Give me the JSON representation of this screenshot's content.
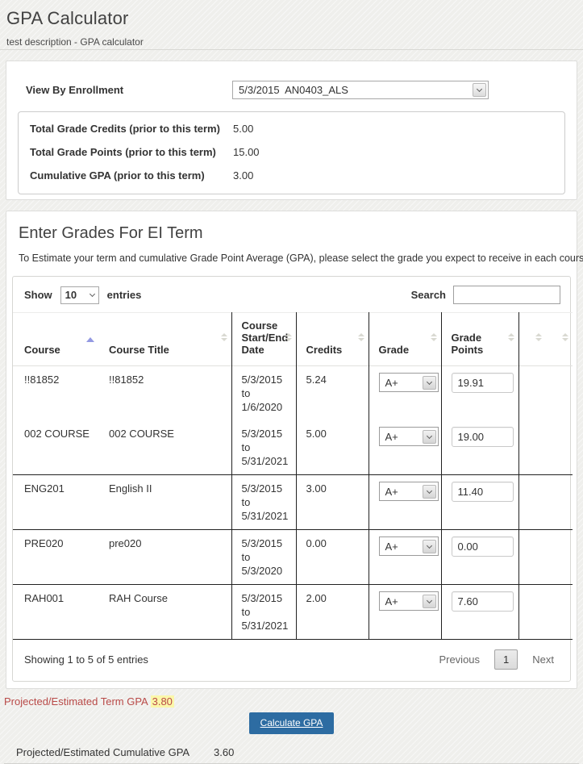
{
  "page": {
    "title": "GPA Calculator",
    "subtitle": "test description - GPA calculator"
  },
  "enrollment": {
    "label": "View By Enrollment",
    "selected_option": "5/3/2015  AN0403_ALS"
  },
  "summary": {
    "credits_label": "Total Grade Credits (prior to this term)",
    "credits_value": "5.00",
    "points_label": "Total Grade Points (prior to this term)",
    "points_value": "15.00",
    "gpa_label": "Cumulative GPA (prior to this term)",
    "gpa_value": "3.00"
  },
  "grades_section": {
    "heading": "Enter Grades For EI Term",
    "description": "To Estimate your term and cumulative Grade Point Average (GPA), please select the grade you expect to receive in each course below.",
    "show_label": "Show",
    "page_size": "10",
    "entries_label": "entries",
    "search_label": "Search",
    "search_value": "",
    "table": {
      "columns": {
        "course": "Course",
        "title": "Course Title",
        "dates": "Course Start/End Date",
        "credits": "Credits",
        "grade": "Grade",
        "points": "Grade Points"
      },
      "rows": [
        {
          "course": "!!81852",
          "title": "!!81852",
          "dates": "5/3/2015 to 1/6/2020",
          "credits": "5.24",
          "grade": "A+",
          "points": "19.91"
        },
        {
          "course": "002 COURSE",
          "title": "002 COURSE",
          "dates": "5/3/2015 to 5/31/2021",
          "credits": "5.00",
          "grade": "A+",
          "points": "19.00"
        },
        {
          "course": "ENG201",
          "title": "English II",
          "dates": "5/3/2015 to 5/31/2021",
          "credits": "3.00",
          "grade": "A+",
          "points": "11.40"
        },
        {
          "course": "PRE020",
          "title": "pre020",
          "dates": "5/3/2015 to 5/3/2020",
          "credits": "0.00",
          "grade": "A+",
          "points": "0.00"
        },
        {
          "course": "RAH001",
          "title": "RAH Course",
          "dates": "5/3/2015 to 5/31/2021",
          "credits": "2.00",
          "grade": "A+",
          "points": "7.60"
        }
      ]
    },
    "footer": {
      "info": "Showing 1 to 5 of 5 entries",
      "previous": "Previous",
      "page": "1",
      "next": "Next"
    }
  },
  "results": {
    "term_label": "Projected/Estimated Term GPA",
    "term_value": "3.80",
    "calculate_button": "Calculate GPA",
    "cumulative_label": "Projected/Estimated Cumulative GPA",
    "cumulative_value": "3.60"
  },
  "colors": {
    "accent_red": "#b94a48",
    "highlight_yellow": "#fbf7a9",
    "button_blue": "#2d6ca2",
    "sort_active_blue": "#9399e2"
  }
}
